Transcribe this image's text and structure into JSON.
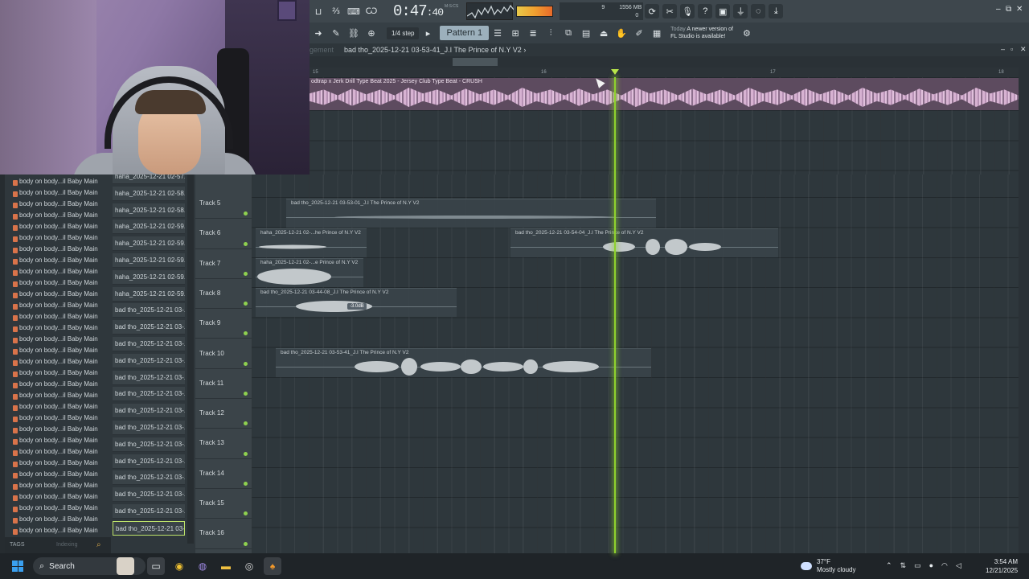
{
  "transport": {
    "time_main": "0:47",
    "time_sub": ":40",
    "time_unit": "M:S:CS",
    "cpu_number": "9",
    "memory": "1556 MB",
    "poly": "0",
    "step": "1/4 step",
    "pattern": "Pattern 1",
    "news_today": "Today",
    "news_line1": "A newer version of",
    "news_line2": "FL Studio is available!"
  },
  "playlist": {
    "dim_label": "gement",
    "title": "bad tho_2025-12-21 03-53-41_J.I The Prince of N.Y V2",
    "title_suffix": "›",
    "ruler": [
      "15",
      "16",
      "17",
      "18"
    ],
    "master_clip": "odtrap x Jerk Drill Type Beat 2025 - Jersey Club Type Beat - CRUSH"
  },
  "tracks": [
    {
      "name": "Track 5"
    },
    {
      "name": "Track 6"
    },
    {
      "name": "Track 7"
    },
    {
      "name": "Track 8"
    },
    {
      "name": "Track 9"
    },
    {
      "name": "Track 10"
    },
    {
      "name": "Track 11"
    },
    {
      "name": "Track 12"
    },
    {
      "name": "Track 13"
    },
    {
      "name": "Track 14"
    },
    {
      "name": "Track 15"
    },
    {
      "name": "Track 16"
    }
  ],
  "clips": {
    "t5": "bad tho_2025-12-21 03-53-01_J.I The Prince of N.Y V2",
    "t6a": "haha_2025-12-21 02-...he Prince of N.Y V2",
    "t6b": "bad tho_2025-12-21 03-54-04_J.I The Prince of N.Y V2",
    "t7": "haha_2025-12-21 02-...e Prince of N.Y V2",
    "t8": "bad tho_2025-12-21 03-44-08_J.I The Prince of N.Y V2",
    "t8_db": "-3.0dB",
    "t10": "bad tho_2025-12-21 03-53-41_J.I The Prince of N.Y V2"
  },
  "browser": {
    "col1": [
      "body on body...il Baby Main",
      "body on body...il Baby Main",
      "body on body...il Baby Main",
      "body on body...il Baby Main",
      "body on body...il Baby Main",
      "body on body...il Baby Main",
      "body on body...il Baby Main",
      "body on body...il Baby Main",
      "body on body...il Baby Main",
      "body on body...il Baby Main",
      "body on body...il Baby Main",
      "body on body...il Baby Main",
      "body on body...il Baby Main",
      "body on body...il Baby Main",
      "body on body...il Baby Main",
      "body on body...il Baby Main",
      "body on body...il Baby Main",
      "body on body...il Baby Main",
      "body on body...il Baby Main",
      "body on body...il Baby Main",
      "body on body...il Baby Main",
      "body on body...il Baby Main",
      "body on body...il Baby Main",
      "body on body...il Baby Main",
      "body on body...il Baby Main",
      "body on body...il Baby Main",
      "body on body...il Baby Main",
      "body on body...il Baby Main",
      "body on body...il Baby Main",
      "body on body...il Baby Main",
      "body on body...il Baby Main",
      "body on body...il Baby Main",
      "body on body...il Baby Main"
    ],
    "col2": [
      "haha_2025-12-21 02-57...",
      "haha_2025-12-21 02-58...",
      "haha_2025-12-21 02-58...",
      "haha_2025-12-21 02-59...",
      "haha_2025-12-21 02-59...",
      "haha_2025-12-21 02-59...",
      "haha_2025-12-21 02-59...",
      "haha_2025-12-21 02-59...",
      "bad tho_2025-12-21 03-...",
      "bad tho_2025-12-21 03-...",
      "bad tho_2025-12-21 03-...",
      "bad tho_2025-12-21 03-...",
      "bad tho_2025-12-21 03-...",
      "bad tho_2025-12-21 03-...",
      "bad tho_2025-12-21 03-...",
      "bad tho_2025-12-21 03-...",
      "bad tho_2025-12-21 03-...",
      "bad tho_2025-12-21 03-...",
      "bad tho_2025-12-21 03-...",
      "bad tho_2025-12-21 03-...",
      "bad tho_2025-12-21 03-...",
      "bad tho_2025-12-21 03-..."
    ],
    "selected_index": 21,
    "tags_label": "TAGS",
    "tags_hint": "Indexing"
  },
  "taskbar": {
    "search": "Search",
    "temp": "37°F",
    "weather": "Mostly cloudy",
    "time": "3:54 AM",
    "date": "12/21/2025"
  }
}
